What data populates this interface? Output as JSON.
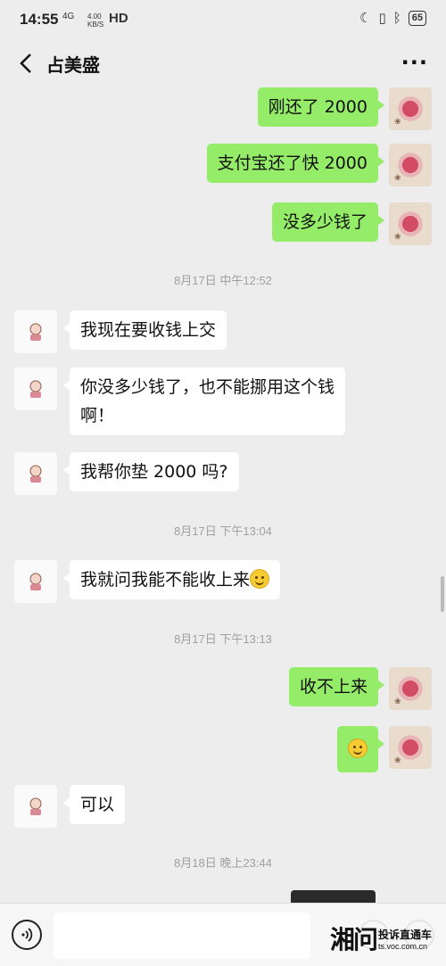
{
  "status_bar": {
    "time": "14:55",
    "network": "4G",
    "speed_value": "4.00",
    "speed_unit": "KB/S",
    "hd": "HD",
    "battery": "65"
  },
  "header": {
    "back_icon": "chevron-left-icon",
    "title": "占美盛",
    "more_icon": "more-dots-icon",
    "more_label": "···"
  },
  "messages": [
    {
      "side": "me",
      "text": "刚还了 2000"
    },
    {
      "side": "me",
      "text": "支付宝还了快 2000"
    },
    {
      "side": "me",
      "text": "没多少钱了"
    },
    {
      "side": "timestamp",
      "text": "8月17日 中午12:52"
    },
    {
      "side": "other",
      "text": "我现在要收钱上交"
    },
    {
      "side": "other",
      "text_line1": "你没多少钱了，也不能挪用这个钱",
      "text_line2": "啊！"
    },
    {
      "side": "other",
      "text": "我帮你垫 2000 吗?"
    },
    {
      "side": "timestamp",
      "text": "8月17日 下午13:04"
    },
    {
      "side": "other",
      "text": "我就问我能不能收上来",
      "emoji": "smile-emoji"
    },
    {
      "side": "timestamp",
      "text": "8月17日 下午13:13"
    },
    {
      "side": "me",
      "text": "收不上来"
    },
    {
      "side": "me",
      "emoji": "smile-emoji"
    },
    {
      "side": "other",
      "text": "可以"
    },
    {
      "side": "timestamp",
      "text": "8月18日 晚上23:44"
    }
  ],
  "input_bar": {
    "voice_icon": "voice-icon",
    "input_value": "",
    "emoji_icon": "emoji-icon",
    "add_icon": "plus-icon",
    "add_label": "+"
  },
  "watermark": {
    "logo": "湘问",
    "name": "投诉直通车",
    "url": "ts.voc.com.cn"
  },
  "colors": {
    "my_bubble": "#95ec69",
    "their_bubble": "#ffffff",
    "background": "#ededed"
  }
}
